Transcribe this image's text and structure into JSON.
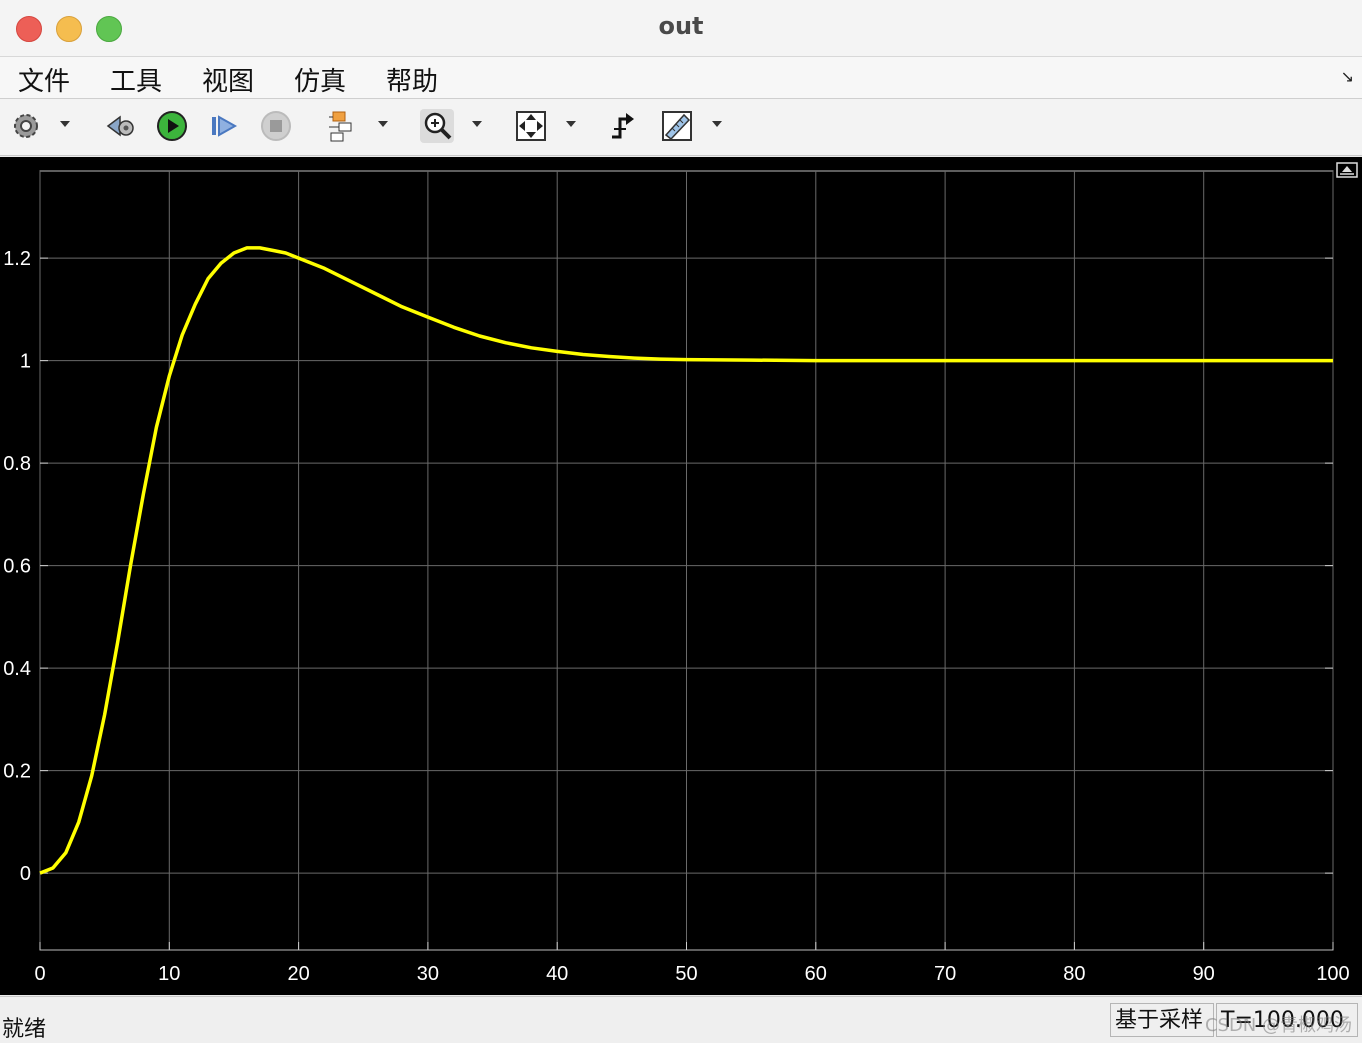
{
  "window": {
    "title": "out"
  },
  "menu": {
    "items": [
      "文件",
      "工具",
      "视图",
      "仿真",
      "帮助"
    ]
  },
  "toolbar": {
    "icons": [
      "gear-icon",
      "step-back-icon",
      "run-icon",
      "step-forward-icon",
      "stop-icon",
      "signal-hierarchy-icon",
      "zoom-icon",
      "fit-view-icon",
      "triggers-icon",
      "measurements-icon"
    ]
  },
  "status": {
    "left": "就绪",
    "sample_mode": "基于采样",
    "time": "T=100.000",
    "watermark": "CSDN @青椒鸡汤"
  },
  "chart_data": {
    "type": "line",
    "title": "",
    "xlabel": "",
    "ylabel": "",
    "xlim": [
      0,
      100
    ],
    "ylim": [
      -0.15,
      1.37
    ],
    "xticks": [
      0,
      10,
      20,
      30,
      40,
      50,
      60,
      70,
      80,
      90,
      100
    ],
    "yticks": [
      0,
      0.2,
      0.4,
      0.6,
      0.8,
      1,
      1.2
    ],
    "yticklabels": [
      "0",
      "0.2",
      "0.4",
      "0.6",
      "0.8",
      "1",
      "1.2"
    ],
    "grid": true,
    "background": "#000000",
    "line_color": "#ffff00",
    "series": [
      {
        "x": [
          0,
          1,
          2,
          3,
          4,
          5,
          6,
          7,
          8,
          9,
          10,
          11,
          12,
          13,
          14,
          15,
          16,
          17,
          18,
          19,
          20,
          22,
          24,
          26,
          28,
          30,
          32,
          34,
          36,
          38,
          40,
          42,
          44,
          46,
          48,
          50,
          55,
          60,
          65,
          70,
          75,
          80,
          90,
          100
        ],
        "y": [
          0,
          0.01,
          0.04,
          0.1,
          0.19,
          0.31,
          0.45,
          0.6,
          0.74,
          0.87,
          0.97,
          1.05,
          1.11,
          1.16,
          1.19,
          1.21,
          1.22,
          1.22,
          1.215,
          1.21,
          1.2,
          1.18,
          1.155,
          1.13,
          1.105,
          1.085,
          1.065,
          1.048,
          1.035,
          1.025,
          1.018,
          1.012,
          1.008,
          1.005,
          1.003,
          1.002,
          1.001,
          1.0,
          1.0,
          1.0,
          1.0,
          1.0,
          1.0,
          1.0
        ]
      }
    ]
  }
}
